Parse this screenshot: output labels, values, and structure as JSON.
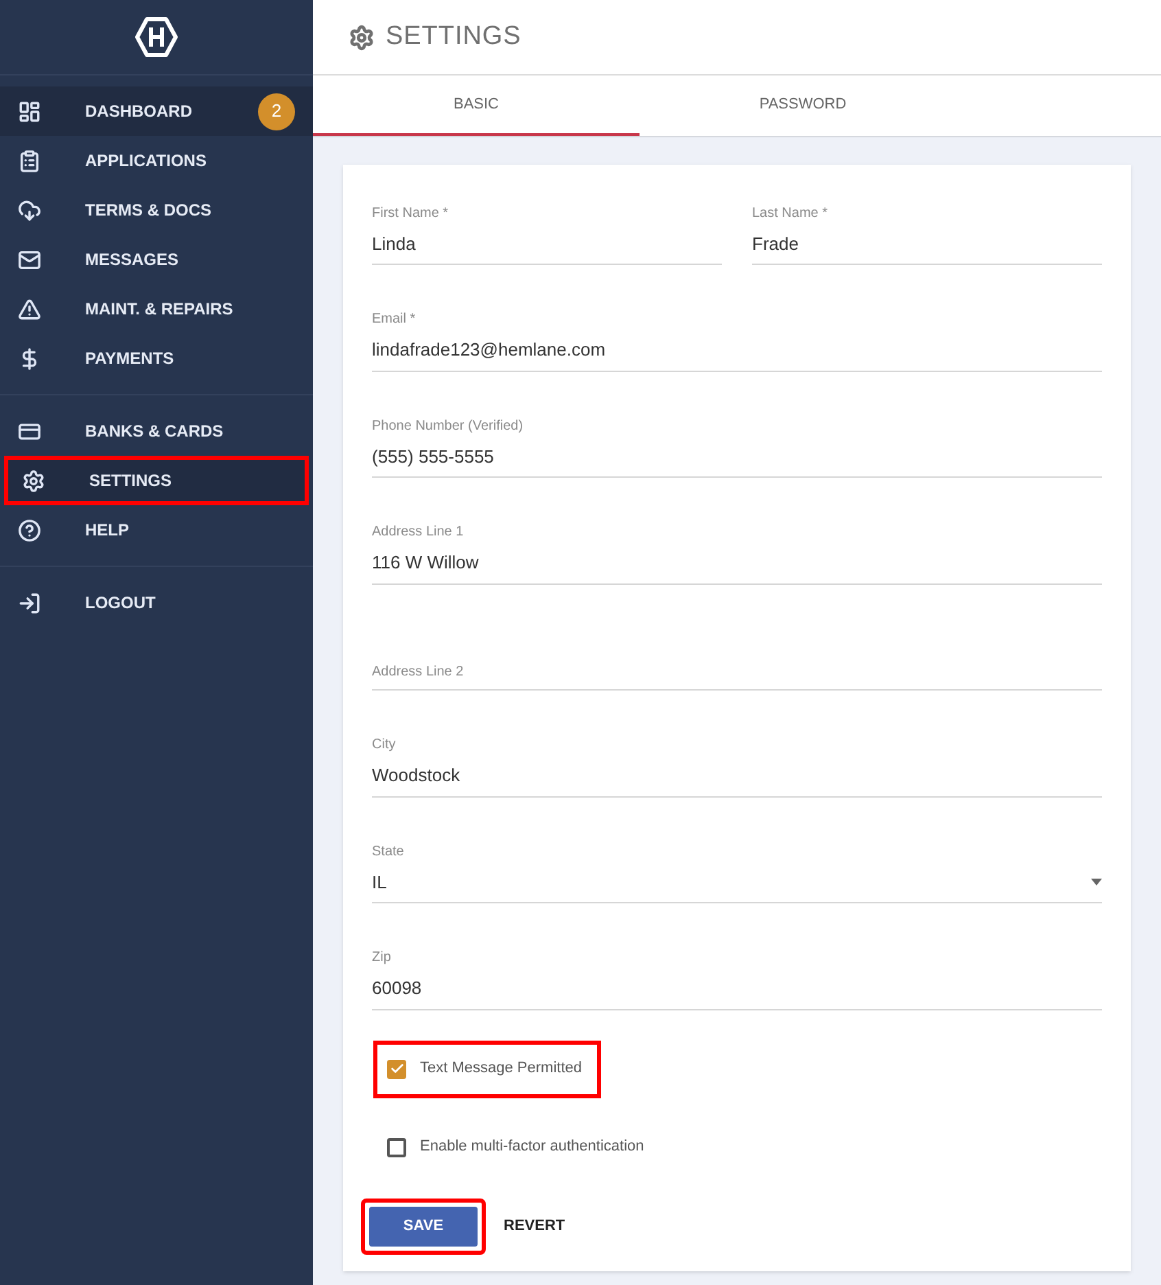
{
  "sidebar": {
    "groups": [
      {
        "items": [
          {
            "label": "DASHBOARD",
            "badge": "2",
            "selected": true,
            "highlighted": false
          },
          {
            "label": "APPLICATIONS",
            "selected": false,
            "highlighted": false
          },
          {
            "label": "TERMS & DOCS",
            "selected": false,
            "highlighted": false
          },
          {
            "label": "MESSAGES",
            "selected": false,
            "highlighted": false
          },
          {
            "label": "MAINT. & REPAIRS",
            "selected": false,
            "highlighted": false
          },
          {
            "label": "PAYMENTS",
            "selected": false,
            "highlighted": false
          }
        ]
      },
      {
        "items": [
          {
            "label": "BANKS & CARDS",
            "selected": false,
            "highlighted": false
          },
          {
            "label": "SETTINGS",
            "selected": true,
            "highlighted": true
          },
          {
            "label": "HELP",
            "selected": false,
            "highlighted": false
          }
        ]
      },
      {
        "items": [
          {
            "label": "LOGOUT",
            "selected": false,
            "highlighted": false
          }
        ]
      }
    ]
  },
  "page": {
    "title": "SETTINGS"
  },
  "tabs": [
    {
      "label": "BASIC",
      "selected": true
    },
    {
      "label": "PASSWORD",
      "selected": false
    }
  ],
  "form": {
    "rows": [
      [
        {
          "label": "First Name *",
          "value": "Linda"
        },
        {
          "label": "Last Name *",
          "value": "Frade"
        }
      ],
      [
        {
          "label": "Email *",
          "value": "lindafrade123@hemlane.com"
        }
      ],
      [
        {
          "label": "Phone Number (Verified)",
          "value": "(555) 555-5555"
        }
      ],
      [
        {
          "label": "Address Line 1",
          "value": "116 W Willow"
        }
      ],
      [
        {
          "label": "Address Line 2"
        }
      ],
      [
        {
          "label": "City",
          "value": "Woodstock"
        }
      ],
      [
        {
          "label": "State",
          "value": "IL",
          "kind": "select"
        }
      ],
      [
        {
          "label": "Zip",
          "value": "60098"
        }
      ]
    ],
    "checkboxes": [
      {
        "label": "Text Message Permitted",
        "checked": true,
        "highlighted": true
      },
      {
        "label": "Enable multi-factor authentication",
        "checked": false,
        "highlighted": false
      }
    ],
    "buttons": [
      {
        "label": "SAVE",
        "kind": "primary",
        "highlighted": true
      },
      {
        "label": "REVERT",
        "kind": "text",
        "highlighted": false
      }
    ]
  }
}
